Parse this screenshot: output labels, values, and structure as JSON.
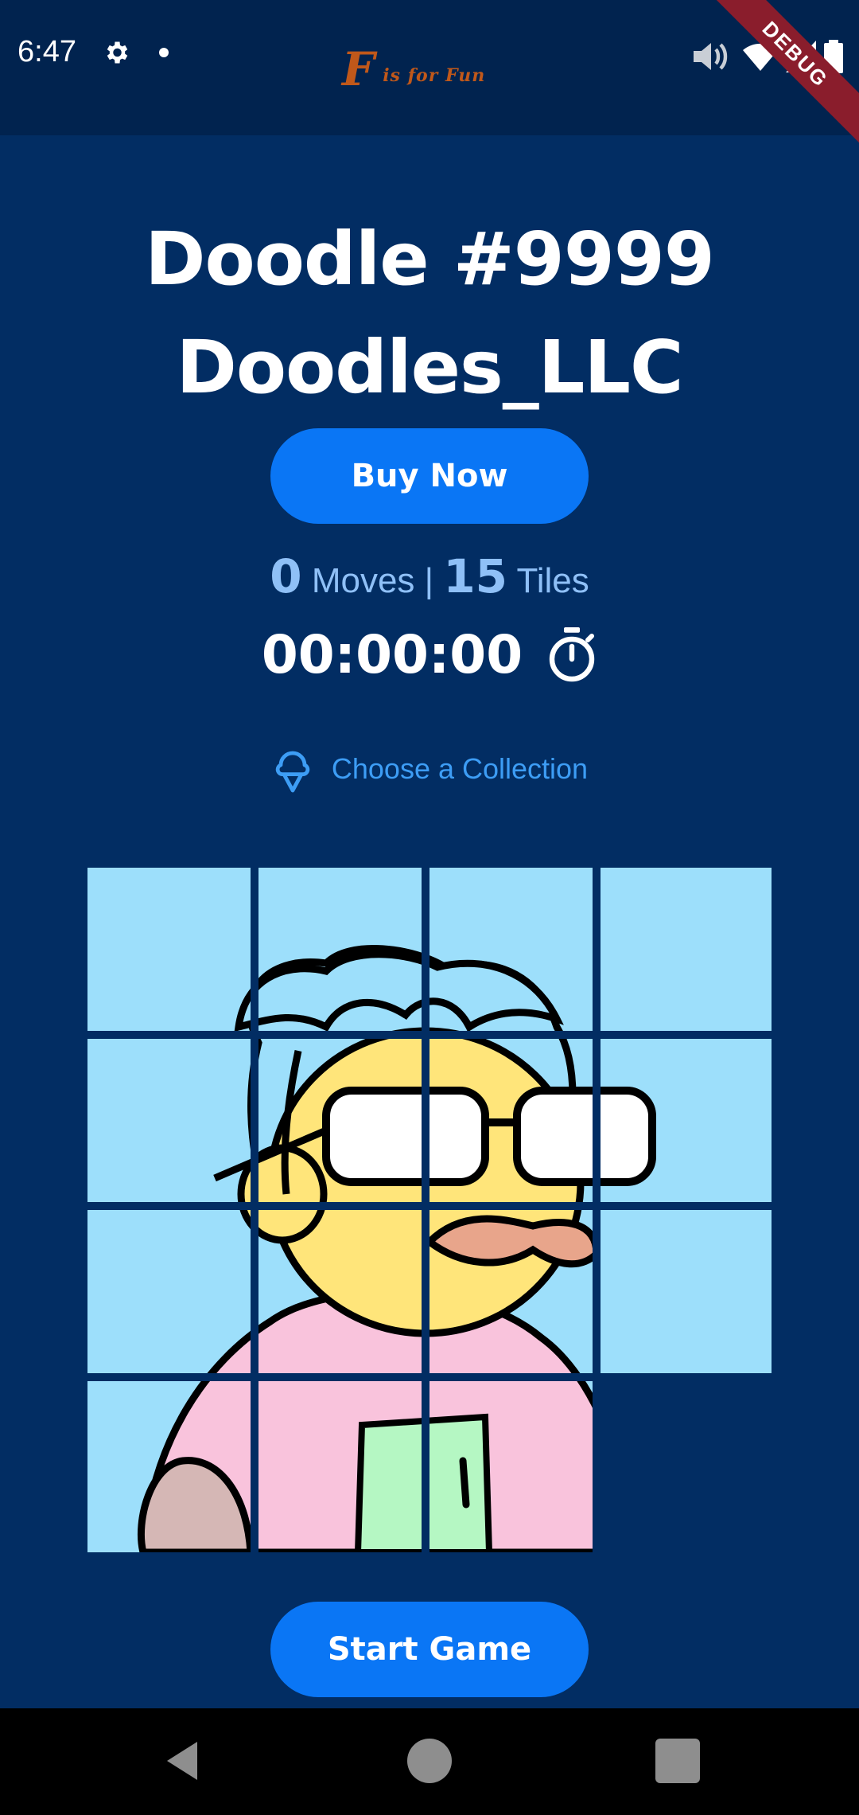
{
  "status_bar": {
    "time": "6:47",
    "icons": [
      "gear-icon",
      "notification-dot-icon",
      "volume-icon",
      "wifi-icon",
      "signal-icon",
      "battery-icon"
    ]
  },
  "app_logo": {
    "big_letter": "F",
    "tagline": "is for Fun"
  },
  "debug_banner": "DEBUG",
  "header": {
    "title": "Doodle #9999",
    "subtitle": "Doodles_LLC"
  },
  "buy_button": "Buy Now",
  "stats": {
    "moves_value": "0",
    "moves_label": "Moves",
    "separator": "|",
    "tiles_value": "15",
    "tiles_label": "Tiles"
  },
  "timer": {
    "value": "00:00:00",
    "icon": "stopwatch-icon"
  },
  "collection": {
    "label": "Choose a Collection",
    "icon": "ice-cream-icon"
  },
  "puzzle": {
    "grid": "4x4",
    "tiles": 15,
    "empty_slot": "bottom-right"
  },
  "start_button": "Start Game",
  "nav_bar": {
    "icons": [
      "back-icon",
      "home-icon",
      "recents-icon"
    ]
  },
  "colors": {
    "background": "#022d63",
    "status_bar": "#01234f",
    "button": "#0a76f5",
    "stats_text": "#8fc0f7",
    "link": "#3d9df5",
    "tile_sky": "#9ddffb"
  }
}
